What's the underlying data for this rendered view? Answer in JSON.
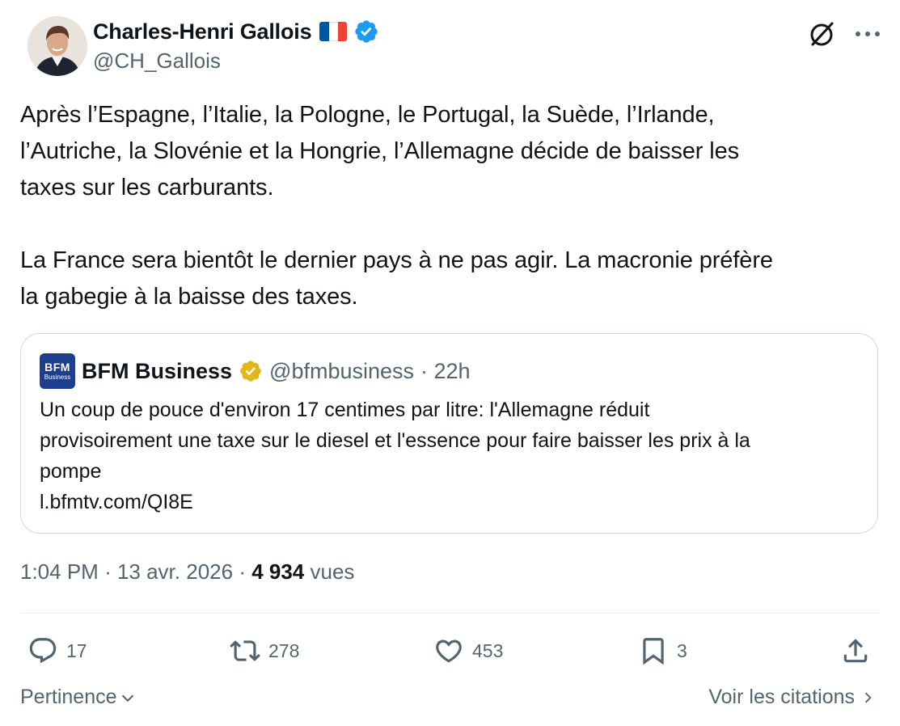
{
  "author": {
    "name": "Charles-Henri Gallois",
    "handle": "@CH_Gallois",
    "flag_colors": [
      "#0055a4",
      "#ffffff",
      "#ef4135"
    ],
    "verified_color": "#1d9bf0"
  },
  "tweet": {
    "text": "Après l’Espagne, l’Italie, la Pologne, le Portugal, la Suède, l’Irlande,\nl’Autriche, la Slovénie et la Hongrie, l’Allemagne décide de baisser les\ntaxes sur les carburants.\n\nLa France sera bientôt le dernier pays à ne pas agir. La macronie préfère\nla gabegie à la baisse des taxes."
  },
  "quote": {
    "logo_line1": "BFM",
    "logo_line2": "Business",
    "name": "BFM Business",
    "handle": "@bfmbusiness",
    "time": "· 22h",
    "text": "Un coup de pouce d'environ 17 centimes par litre: l'Allemagne réduit\nprovisoirement une taxe sur le diesel et l'essence pour faire baisser les prix à la\npompe\nl.bfmtv.com/QI8E",
    "badge_color": "#e2b719"
  },
  "meta": {
    "time": "1:04 PM",
    "date": "13 avr. 2026",
    "views_count": "4 934",
    "views_label": "vues"
  },
  "actions": {
    "replies": "17",
    "reposts": "278",
    "likes": "453",
    "bookmarks": "3"
  },
  "footer": {
    "sort_label": "Pertinence",
    "citations_label": "Voir les citations"
  },
  "icons": [
    "grok-icon",
    "more-icon",
    "verified-icon",
    "reply-icon",
    "repost-icon",
    "like-icon",
    "bookmark-icon",
    "share-icon",
    "chevron-down-icon",
    "chevron-right-icon"
  ]
}
